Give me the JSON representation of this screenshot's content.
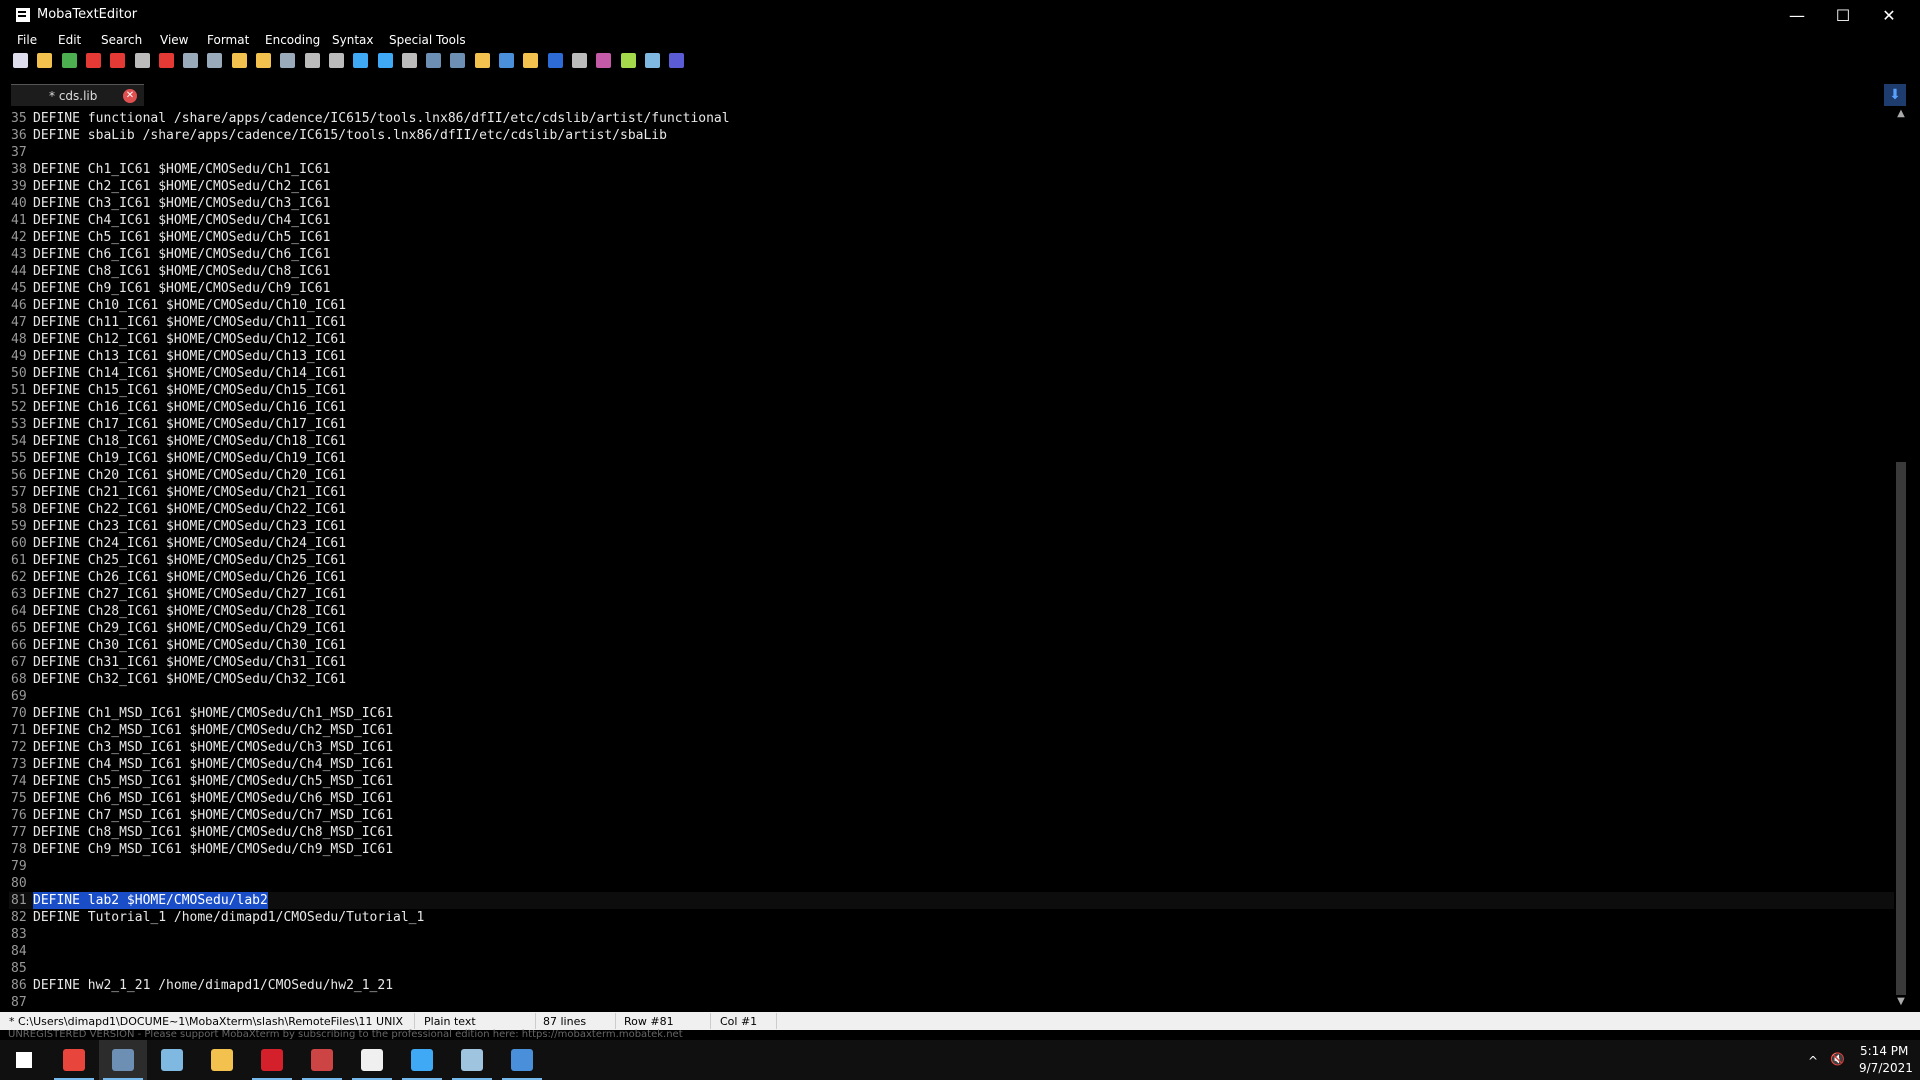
{
  "window": {
    "title": "MobaTextEditor",
    "minimize_glyph": "—",
    "maximize_glyph": "☐",
    "close_glyph": "✕"
  },
  "menu": [
    "File",
    "Edit",
    "Search",
    "View",
    "Format",
    "Encoding",
    "Syntax",
    "Special Tools"
  ],
  "toolbar_icons": [
    "new-file-icon",
    "open-folder-icon",
    "reload-icon",
    "save-icon",
    "save-as-icon",
    "print-icon",
    "close-file-icon",
    "indent-icon",
    "unindent-icon",
    "bookmark-icon",
    "bookmark-next-icon",
    "cut-icon",
    "copy-icon",
    "paste-icon",
    "find-icon",
    "find-replace-icon",
    "goto-line-icon",
    "compare-icon",
    "duplicate-icon",
    "windows-icon",
    "mac-icon",
    "linux-icon",
    "undo-icon",
    "page-icon",
    "paragraph-icon",
    "highlight-icon",
    "settings-icon",
    "close-all-icon"
  ],
  "tab": {
    "label": "* cds.lib",
    "close_glyph": "✕"
  },
  "download_glyph": "⬇",
  "editor": {
    "lines": [
      {
        "n": "35",
        "text": "DEFINE functional /share/apps/cadence/IC615/tools.lnx86/dfII/etc/cdslib/artist/functional"
      },
      {
        "n": "36",
        "text": "DEFINE sbaLib /share/apps/cadence/IC615/tools.lnx86/dfII/etc/cdslib/artist/sbaLib"
      },
      {
        "n": "37",
        "text": ""
      },
      {
        "n": "38",
        "text": "DEFINE Ch1_IC61 $HOME/CMOSedu/Ch1_IC61"
      },
      {
        "n": "39",
        "text": "DEFINE Ch2_IC61 $HOME/CMOSedu/Ch2_IC61"
      },
      {
        "n": "40",
        "text": "DEFINE Ch3_IC61 $HOME/CMOSedu/Ch3_IC61"
      },
      {
        "n": "41",
        "text": "DEFINE Ch4_IC61 $HOME/CMOSedu/Ch4_IC61"
      },
      {
        "n": "42",
        "text": "DEFINE Ch5_IC61 $HOME/CMOSedu/Ch5_IC61"
      },
      {
        "n": "43",
        "text": "DEFINE Ch6_IC61 $HOME/CMOSedu/Ch6_IC61"
      },
      {
        "n": "44",
        "text": "DEFINE Ch8_IC61 $HOME/CMOSedu/Ch8_IC61"
      },
      {
        "n": "45",
        "text": "DEFINE Ch9_IC61 $HOME/CMOSedu/Ch9_IC61"
      },
      {
        "n": "46",
        "text": "DEFINE Ch10_IC61 $HOME/CMOSedu/Ch10_IC61"
      },
      {
        "n": "47",
        "text": "DEFINE Ch11_IC61 $HOME/CMOSedu/Ch11_IC61"
      },
      {
        "n": "48",
        "text": "DEFINE Ch12_IC61 $HOME/CMOSedu/Ch12_IC61"
      },
      {
        "n": "49",
        "text": "DEFINE Ch13_IC61 $HOME/CMOSedu/Ch13_IC61"
      },
      {
        "n": "50",
        "text": "DEFINE Ch14_IC61 $HOME/CMOSedu/Ch14_IC61"
      },
      {
        "n": "51",
        "text": "DEFINE Ch15_IC61 $HOME/CMOSedu/Ch15_IC61"
      },
      {
        "n": "52",
        "text": "DEFINE Ch16_IC61 $HOME/CMOSedu/Ch16_IC61"
      },
      {
        "n": "53",
        "text": "DEFINE Ch17_IC61 $HOME/CMOSedu/Ch17_IC61"
      },
      {
        "n": "54",
        "text": "DEFINE Ch18_IC61 $HOME/CMOSedu/Ch18_IC61"
      },
      {
        "n": "55",
        "text": "DEFINE Ch19_IC61 $HOME/CMOSedu/Ch19_IC61"
      },
      {
        "n": "56",
        "text": "DEFINE Ch20_IC61 $HOME/CMOSedu/Ch20_IC61"
      },
      {
        "n": "57",
        "text": "DEFINE Ch21_IC61 $HOME/CMOSedu/Ch21_IC61"
      },
      {
        "n": "58",
        "text": "DEFINE Ch22_IC61 $HOME/CMOSedu/Ch22_IC61"
      },
      {
        "n": "59",
        "text": "DEFINE Ch23_IC61 $HOME/CMOSedu/Ch23_IC61"
      },
      {
        "n": "60",
        "text": "DEFINE Ch24_IC61 $HOME/CMOSedu/Ch24_IC61"
      },
      {
        "n": "61",
        "text": "DEFINE Ch25_IC61 $HOME/CMOSedu/Ch25_IC61"
      },
      {
        "n": "62",
        "text": "DEFINE Ch26_IC61 $HOME/CMOSedu/Ch26_IC61"
      },
      {
        "n": "63",
        "text": "DEFINE Ch27_IC61 $HOME/CMOSedu/Ch27_IC61"
      },
      {
        "n": "64",
        "text": "DEFINE Ch28_IC61 $HOME/CMOSedu/Ch28_IC61"
      },
      {
        "n": "65",
        "text": "DEFINE Ch29_IC61 $HOME/CMOSedu/Ch29_IC61"
      },
      {
        "n": "66",
        "text": "DEFINE Ch30_IC61 $HOME/CMOSedu/Ch30_IC61"
      },
      {
        "n": "67",
        "text": "DEFINE Ch31_IC61 $HOME/CMOSedu/Ch31_IC61"
      },
      {
        "n": "68",
        "text": "DEFINE Ch32_IC61 $HOME/CMOSedu/Ch32_IC61"
      },
      {
        "n": "69",
        "text": ""
      },
      {
        "n": "70",
        "text": "DEFINE Ch1_MSD_IC61 $HOME/CMOSedu/Ch1_MSD_IC61"
      },
      {
        "n": "71",
        "text": "DEFINE Ch2_MSD_IC61 $HOME/CMOSedu/Ch2_MSD_IC61"
      },
      {
        "n": "72",
        "text": "DEFINE Ch3_MSD_IC61 $HOME/CMOSedu/Ch3_MSD_IC61"
      },
      {
        "n": "73",
        "text": "DEFINE Ch4_MSD_IC61 $HOME/CMOSedu/Ch4_MSD_IC61"
      },
      {
        "n": "74",
        "text": "DEFINE Ch5_MSD_IC61 $HOME/CMOSedu/Ch5_MSD_IC61"
      },
      {
        "n": "75",
        "text": "DEFINE Ch6_MSD_IC61 $HOME/CMOSedu/Ch6_MSD_IC61"
      },
      {
        "n": "76",
        "text": "DEFINE Ch7_MSD_IC61 $HOME/CMOSedu/Ch7_MSD_IC61"
      },
      {
        "n": "77",
        "text": "DEFINE Ch8_MSD_IC61 $HOME/CMOSedu/Ch8_MSD_IC61"
      },
      {
        "n": "78",
        "text": "DEFINE Ch9_MSD_IC61 $HOME/CMOSedu/Ch9_MSD_IC61"
      },
      {
        "n": "79",
        "text": ""
      },
      {
        "n": "80",
        "text": ""
      },
      {
        "n": "81",
        "text": "DEFINE lab2 $HOME/CMOSedu/lab2",
        "current": true
      },
      {
        "n": "82",
        "text": "DEFINE Tutorial_1 /home/dimapd1/CMOSedu/Tutorial_1"
      },
      {
        "n": "83",
        "text": ""
      },
      {
        "n": "84",
        "text": ""
      },
      {
        "n": "85",
        "text": ""
      },
      {
        "n": "86",
        "text": "DEFINE hw2_1_21 /home/dimapd1/CMOSedu/hw2_1_21"
      },
      {
        "n": "87",
        "text": ""
      }
    ]
  },
  "status": {
    "path": "* C:\\Users\\dimapd1\\DOCUME~1\\MobaXterm\\slash\\RemoteFiles\\11 UNIX",
    "syntax": "Plain text",
    "lines": "87 lines",
    "row": "Row #81",
    "col": "Col #1"
  },
  "unregistered": "UNREGISTERED VERSION  -  Please support MobaXterm by subscribing to the professional edition here:  https://mobaxterm.mobatek.net",
  "taskbar": {
    "apps": [
      {
        "name": "windows-start-icon",
        "color": "#ffffff"
      },
      {
        "name": "chrome-icon",
        "color": "#e8453c",
        "running": true
      },
      {
        "name": "mobaxterm-icon",
        "color": "#6d8fb3",
        "running": true,
        "active": true
      },
      {
        "name": "pen-app-icon",
        "color": "#7fb8e0"
      },
      {
        "name": "file-explorer-icon",
        "color": "#f2c14e"
      },
      {
        "name": "acrobat-icon",
        "color": "#d4202a",
        "running": true
      },
      {
        "name": "remote-app-icon",
        "color": "#c44",
        "running": true
      },
      {
        "name": "terminal-app-icon",
        "color": "#f0f0f0",
        "running": true
      },
      {
        "name": "x-server-icon",
        "color": "#3fa9f5",
        "running": true
      },
      {
        "name": "paint-app-icon",
        "color": "#9ec4e0",
        "running": true
      },
      {
        "name": "text-editor-icon",
        "color": "#4a8fd9",
        "running": true
      }
    ],
    "time": "5:14 PM",
    "date": "9/7/2021",
    "chevron": "^",
    "speaker": "🔇"
  }
}
